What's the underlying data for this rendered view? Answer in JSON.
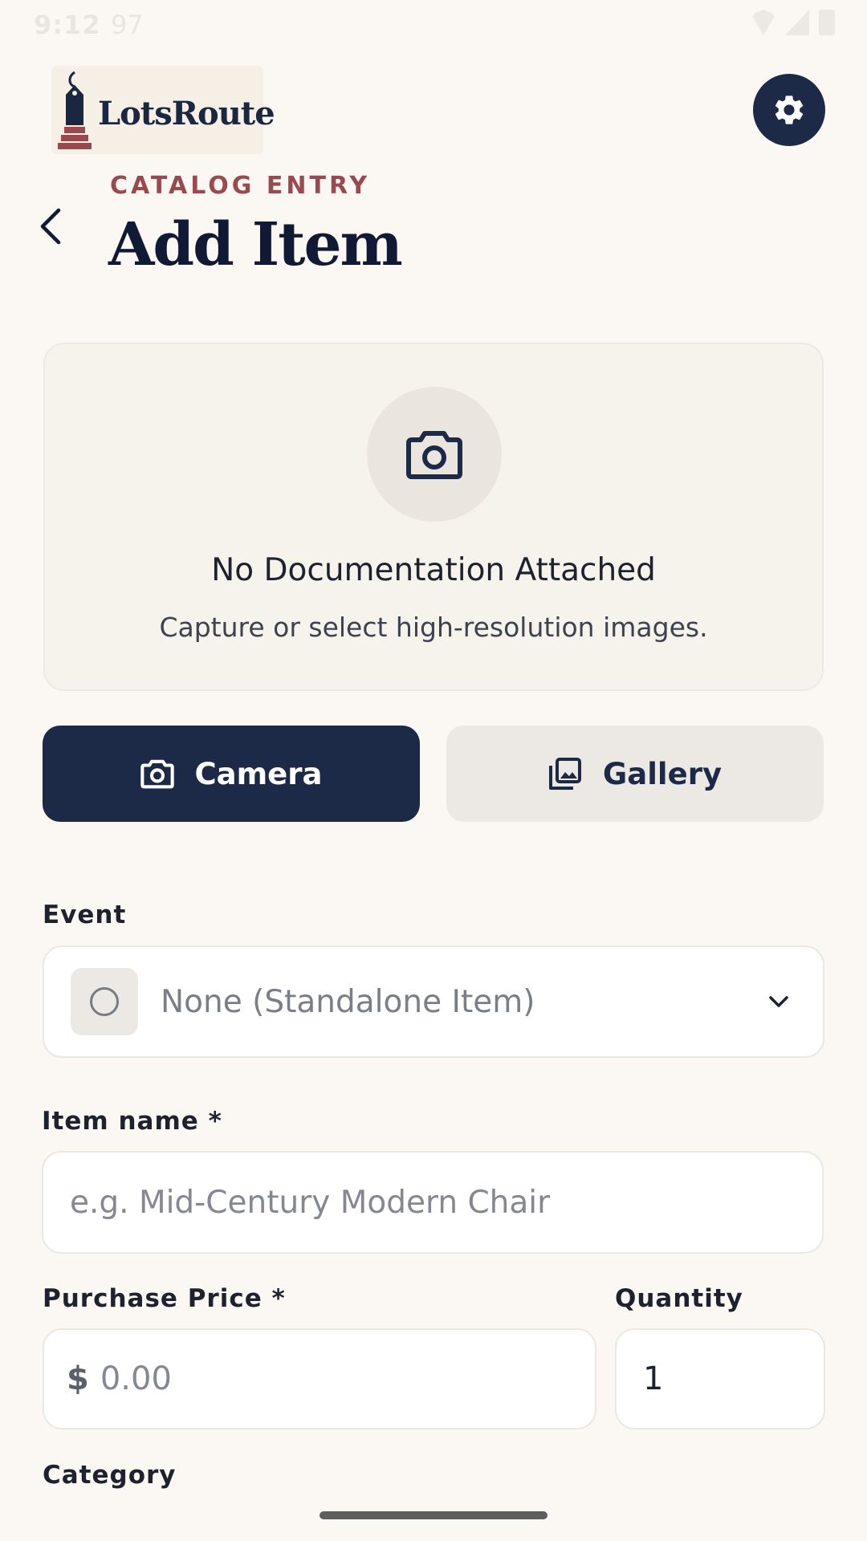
{
  "status_bar": {
    "time": "9:12",
    "misc": "97"
  },
  "app": {
    "name": "LotsRoute"
  },
  "header": {
    "eyebrow": "CATALOG ENTRY",
    "title": "Add Item"
  },
  "documentation": {
    "title": "No Documentation Attached",
    "subtitle": "Capture or select high-resolution images."
  },
  "actions": {
    "camera_label": "Camera",
    "gallery_label": "Gallery"
  },
  "form": {
    "event": {
      "label": "Event",
      "value": "None (Standalone Item)"
    },
    "item_name": {
      "label": "Item name *",
      "placeholder": "e.g. Mid-Century Modern Chair"
    },
    "purchase_price": {
      "label": "Purchase Price *",
      "currency": "$",
      "placeholder": "0.00"
    },
    "quantity": {
      "label": "Quantity",
      "value": "1"
    },
    "category": {
      "label": "Category"
    }
  },
  "colors": {
    "navy": "#1C2A48",
    "accent_red": "#9A4A4F",
    "background": "#FBF8F4"
  },
  "icons": [
    "settings-gear-icon",
    "back-chevron-icon",
    "camera-icon",
    "gallery-icon",
    "radio-circle-icon",
    "chevron-down-icon"
  ]
}
